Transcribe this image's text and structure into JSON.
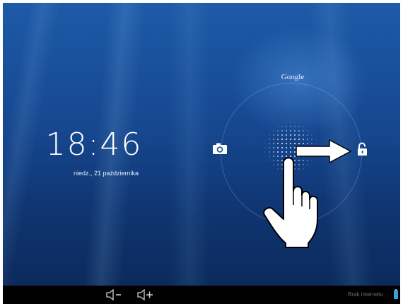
{
  "lockscreen": {
    "time": "18:46",
    "date": "niedz., 21 października",
    "search_label": "Google"
  },
  "navbar": {
    "status_text": "Brak internetu"
  },
  "icons": {
    "camera": "camera-icon",
    "unlock": "unlock-icon",
    "volume_down": "volume-down-icon",
    "volume_up": "volume-up-icon",
    "battery": "battery-icon"
  },
  "colors": {
    "wallpaper": "#16478f",
    "navbar": "#000000",
    "text": "#ffffff",
    "status_text": "#6d6d6d",
    "battery": "#3aa0e0"
  }
}
